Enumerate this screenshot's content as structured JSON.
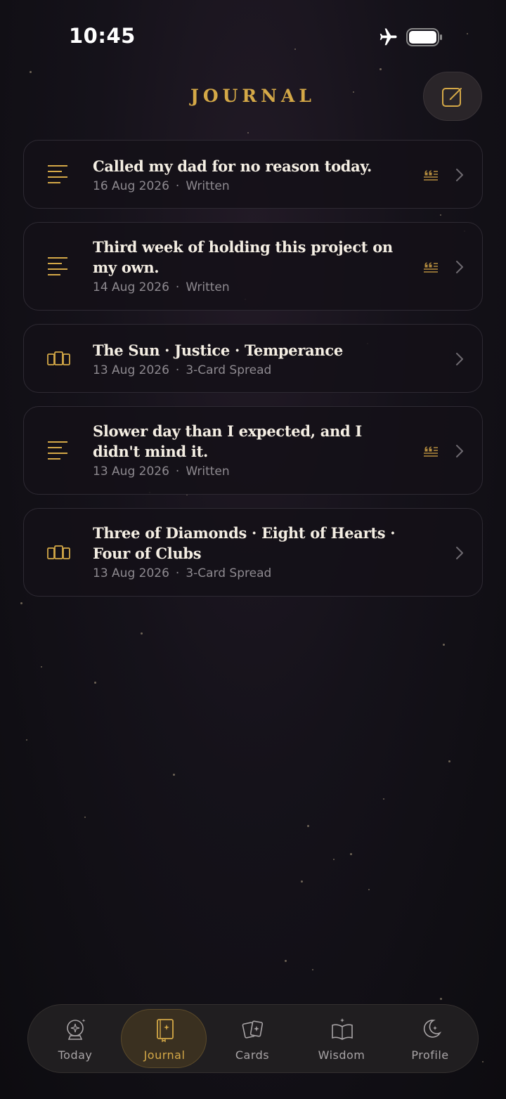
{
  "status_bar": {
    "time": "10:45"
  },
  "header": {
    "title": "JOURNAL",
    "compose_icon": "compose-icon"
  },
  "colors": {
    "accent_gold": "#d4a847",
    "background": "#15121a",
    "card_border": "#2e2a33",
    "meta_text": "#8e8a90"
  },
  "entries": [
    {
      "title": "Called my dad for no reason today.",
      "date": "16 Aug 2026",
      "separator": "·",
      "kind": "Written",
      "icon": "text-lines-icon",
      "has_quote": true
    },
    {
      "title": "Third week of holding this project on my own.",
      "date": "14 Aug 2026",
      "separator": "·",
      "kind": "Written",
      "icon": "text-lines-icon",
      "has_quote": true
    },
    {
      "title": "The Sun · Justice · Temperance",
      "date": "13 Aug 2026",
      "separator": "·",
      "kind": "3-Card Spread",
      "icon": "cards-spread-icon",
      "has_quote": false
    },
    {
      "title": "Slower day than I expected, and I didn't mind it.",
      "date": "13 Aug 2026",
      "separator": "·",
      "kind": "Written",
      "icon": "text-lines-icon",
      "has_quote": true
    },
    {
      "title": "Three of Diamonds · Eight of Hearts · Four of Clubs",
      "date": "13 Aug 2026",
      "separator": "·",
      "kind": "3-Card Spread",
      "icon": "cards-spread-icon",
      "has_quote": false
    }
  ],
  "tab_bar": {
    "active": "Journal",
    "tabs": [
      {
        "label": "Today",
        "icon": "crystal-ball-icon"
      },
      {
        "label": "Journal",
        "icon": "journal-book-icon"
      },
      {
        "label": "Cards",
        "icon": "cards-icon"
      },
      {
        "label": "Wisdom",
        "icon": "open-book-icon"
      },
      {
        "label": "Profile",
        "icon": "moon-icon"
      }
    ]
  }
}
